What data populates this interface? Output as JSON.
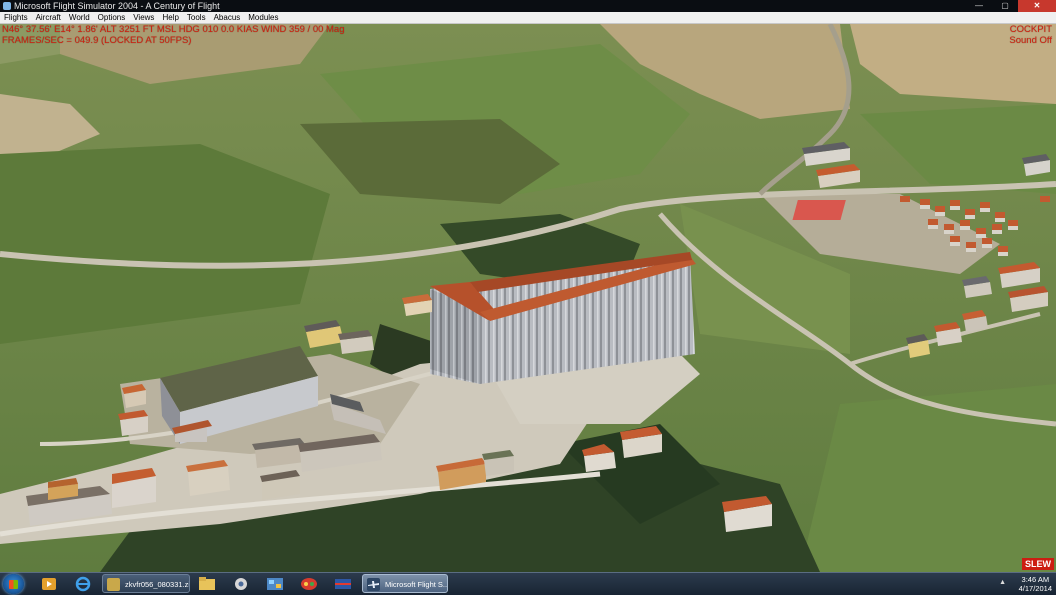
{
  "window": {
    "title": "Microsoft Flight Simulator 2004 - A Century of Flight",
    "minimize": "—",
    "maximize": "▢",
    "close": "✕"
  },
  "menu": {
    "items": [
      "Flights",
      "Aircraft",
      "World",
      "Options",
      "Views",
      "Help",
      "Tools",
      "Abacus",
      "Modules"
    ]
  },
  "hud": {
    "position_line": "N46° 37.56'  E14° 1.86'  ALT  3251 FT  MSL  HDG 010    0.0 KIAS  WIND 359 / 00 Mag",
    "fps_line": "FRAMES/SEC = 049.9 (LOCKED AT 50FPS)",
    "view_mode": "COCKPIT",
    "sound_status": "Sound Off",
    "slew_label": "SLEW"
  },
  "taskbar": {
    "tasks": [
      {
        "label": "zkvfr056_080331.zi...",
        "icon": "archive-icon"
      },
      {
        "label": "Microsoft Flight S...",
        "icon": "airplane-icon"
      }
    ],
    "clock_time": "3:46 AM",
    "clock_date": "4/17/2014",
    "tray_arrow": "▲"
  },
  "colors": {
    "hud_red": "#d2200f",
    "grass": "#6f8a4a",
    "roof": "#c4582f"
  }
}
